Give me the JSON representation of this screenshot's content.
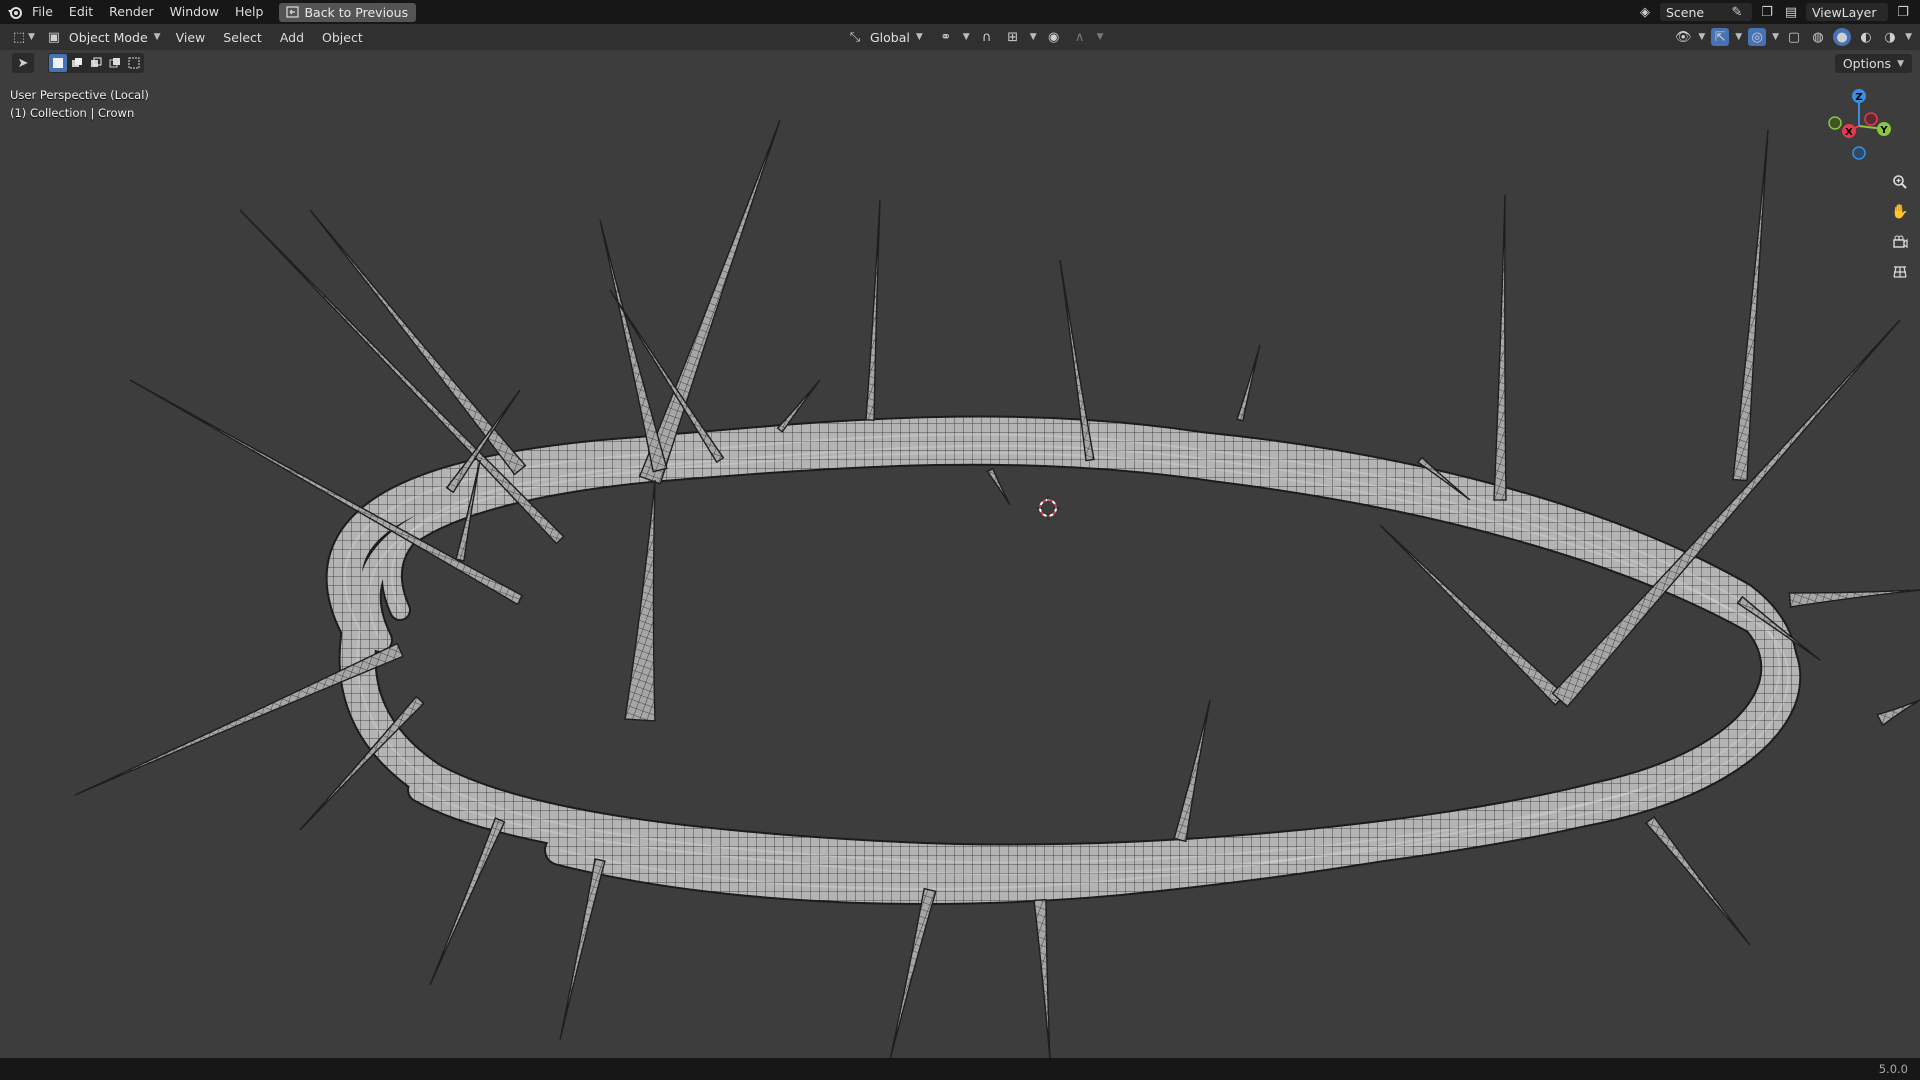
{
  "topbar": {
    "menu": [
      "File",
      "Edit",
      "Render",
      "Window",
      "Help"
    ],
    "back_label": "Back to Previous",
    "scene_label": "Scene",
    "view_layer_label": "ViewLayer"
  },
  "header": {
    "mode_label": "Object Mode",
    "menu": [
      "View",
      "Select",
      "Add",
      "Object"
    ],
    "orientation_label": "Global",
    "options_label": "Options"
  },
  "viewport": {
    "perspective_label": "User Perspective (Local)",
    "collection_label": "(1) Collection | Crown",
    "object": "Crown of thorns mesh (wireframe on solid)"
  },
  "gizmo": {
    "x": "X",
    "y": "Y",
    "z": "Z"
  },
  "status": {
    "version": "5.0.0"
  },
  "colors": {
    "accent": "#4772b3",
    "axis_x": "#e8384f",
    "axis_y": "#8ac63f",
    "axis_z": "#3a8fe3"
  }
}
